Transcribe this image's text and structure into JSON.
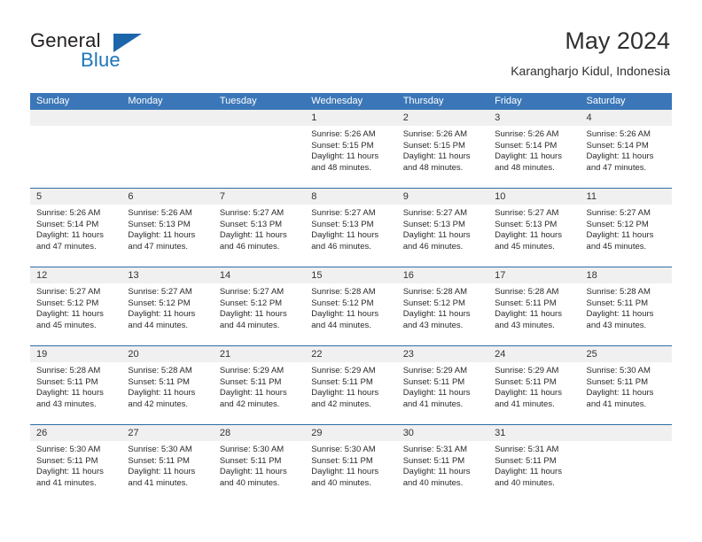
{
  "brand": {
    "word_general": "General",
    "word_blue": "Blue",
    "flag_icon": "blue-triangle-flag-icon"
  },
  "header": {
    "title": "May 2024",
    "subtitle": "Karangharjo Kidul, Indonesia"
  },
  "colors": {
    "header_blue": "#3b77b8",
    "row_divider_blue": "#2e6da4",
    "day_band_gray": "#f0f0f0",
    "brand_blue": "#1b75bb",
    "text": "#2a2a2a"
  },
  "weekdays": [
    "Sunday",
    "Monday",
    "Tuesday",
    "Wednesday",
    "Thursday",
    "Friday",
    "Saturday"
  ],
  "weeks": [
    [
      {
        "day": "",
        "sunrise": "",
        "sunset": "",
        "daylight_line1": "",
        "daylight_line2": "",
        "empty": true
      },
      {
        "day": "",
        "sunrise": "",
        "sunset": "",
        "daylight_line1": "",
        "daylight_line2": "",
        "empty": true
      },
      {
        "day": "",
        "sunrise": "",
        "sunset": "",
        "daylight_line1": "",
        "daylight_line2": "",
        "empty": true
      },
      {
        "day": "1",
        "sunrise": "Sunrise: 5:26 AM",
        "sunset": "Sunset: 5:15 PM",
        "daylight_line1": "Daylight: 11 hours",
        "daylight_line2": "and 48 minutes.",
        "empty": false
      },
      {
        "day": "2",
        "sunrise": "Sunrise: 5:26 AM",
        "sunset": "Sunset: 5:15 PM",
        "daylight_line1": "Daylight: 11 hours",
        "daylight_line2": "and 48 minutes.",
        "empty": false
      },
      {
        "day": "3",
        "sunrise": "Sunrise: 5:26 AM",
        "sunset": "Sunset: 5:14 PM",
        "daylight_line1": "Daylight: 11 hours",
        "daylight_line2": "and 48 minutes.",
        "empty": false
      },
      {
        "day": "4",
        "sunrise": "Sunrise: 5:26 AM",
        "sunset": "Sunset: 5:14 PM",
        "daylight_line1": "Daylight: 11 hours",
        "daylight_line2": "and 47 minutes.",
        "empty": false
      }
    ],
    [
      {
        "day": "5",
        "sunrise": "Sunrise: 5:26 AM",
        "sunset": "Sunset: 5:14 PM",
        "daylight_line1": "Daylight: 11 hours",
        "daylight_line2": "and 47 minutes.",
        "empty": false
      },
      {
        "day": "6",
        "sunrise": "Sunrise: 5:26 AM",
        "sunset": "Sunset: 5:13 PM",
        "daylight_line1": "Daylight: 11 hours",
        "daylight_line2": "and 47 minutes.",
        "empty": false
      },
      {
        "day": "7",
        "sunrise": "Sunrise: 5:27 AM",
        "sunset": "Sunset: 5:13 PM",
        "daylight_line1": "Daylight: 11 hours",
        "daylight_line2": "and 46 minutes.",
        "empty": false
      },
      {
        "day": "8",
        "sunrise": "Sunrise: 5:27 AM",
        "sunset": "Sunset: 5:13 PM",
        "daylight_line1": "Daylight: 11 hours",
        "daylight_line2": "and 46 minutes.",
        "empty": false
      },
      {
        "day": "9",
        "sunrise": "Sunrise: 5:27 AM",
        "sunset": "Sunset: 5:13 PM",
        "daylight_line1": "Daylight: 11 hours",
        "daylight_line2": "and 46 minutes.",
        "empty": false
      },
      {
        "day": "10",
        "sunrise": "Sunrise: 5:27 AM",
        "sunset": "Sunset: 5:13 PM",
        "daylight_line1": "Daylight: 11 hours",
        "daylight_line2": "and 45 minutes.",
        "empty": false
      },
      {
        "day": "11",
        "sunrise": "Sunrise: 5:27 AM",
        "sunset": "Sunset: 5:12 PM",
        "daylight_line1": "Daylight: 11 hours",
        "daylight_line2": "and 45 minutes.",
        "empty": false
      }
    ],
    [
      {
        "day": "12",
        "sunrise": "Sunrise: 5:27 AM",
        "sunset": "Sunset: 5:12 PM",
        "daylight_line1": "Daylight: 11 hours",
        "daylight_line2": "and 45 minutes.",
        "empty": false
      },
      {
        "day": "13",
        "sunrise": "Sunrise: 5:27 AM",
        "sunset": "Sunset: 5:12 PM",
        "daylight_line1": "Daylight: 11 hours",
        "daylight_line2": "and 44 minutes.",
        "empty": false
      },
      {
        "day": "14",
        "sunrise": "Sunrise: 5:27 AM",
        "sunset": "Sunset: 5:12 PM",
        "daylight_line1": "Daylight: 11 hours",
        "daylight_line2": "and 44 minutes.",
        "empty": false
      },
      {
        "day": "15",
        "sunrise": "Sunrise: 5:28 AM",
        "sunset": "Sunset: 5:12 PM",
        "daylight_line1": "Daylight: 11 hours",
        "daylight_line2": "and 44 minutes.",
        "empty": false
      },
      {
        "day": "16",
        "sunrise": "Sunrise: 5:28 AM",
        "sunset": "Sunset: 5:12 PM",
        "daylight_line1": "Daylight: 11 hours",
        "daylight_line2": "and 43 minutes.",
        "empty": false
      },
      {
        "day": "17",
        "sunrise": "Sunrise: 5:28 AM",
        "sunset": "Sunset: 5:11 PM",
        "daylight_line1": "Daylight: 11 hours",
        "daylight_line2": "and 43 minutes.",
        "empty": false
      },
      {
        "day": "18",
        "sunrise": "Sunrise: 5:28 AM",
        "sunset": "Sunset: 5:11 PM",
        "daylight_line1": "Daylight: 11 hours",
        "daylight_line2": "and 43 minutes.",
        "empty": false
      }
    ],
    [
      {
        "day": "19",
        "sunrise": "Sunrise: 5:28 AM",
        "sunset": "Sunset: 5:11 PM",
        "daylight_line1": "Daylight: 11 hours",
        "daylight_line2": "and 43 minutes.",
        "empty": false
      },
      {
        "day": "20",
        "sunrise": "Sunrise: 5:28 AM",
        "sunset": "Sunset: 5:11 PM",
        "daylight_line1": "Daylight: 11 hours",
        "daylight_line2": "and 42 minutes.",
        "empty": false
      },
      {
        "day": "21",
        "sunrise": "Sunrise: 5:29 AM",
        "sunset": "Sunset: 5:11 PM",
        "daylight_line1": "Daylight: 11 hours",
        "daylight_line2": "and 42 minutes.",
        "empty": false
      },
      {
        "day": "22",
        "sunrise": "Sunrise: 5:29 AM",
        "sunset": "Sunset: 5:11 PM",
        "daylight_line1": "Daylight: 11 hours",
        "daylight_line2": "and 42 minutes.",
        "empty": false
      },
      {
        "day": "23",
        "sunrise": "Sunrise: 5:29 AM",
        "sunset": "Sunset: 5:11 PM",
        "daylight_line1": "Daylight: 11 hours",
        "daylight_line2": "and 41 minutes.",
        "empty": false
      },
      {
        "day": "24",
        "sunrise": "Sunrise: 5:29 AM",
        "sunset": "Sunset: 5:11 PM",
        "daylight_line1": "Daylight: 11 hours",
        "daylight_line2": "and 41 minutes.",
        "empty": false
      },
      {
        "day": "25",
        "sunrise": "Sunrise: 5:30 AM",
        "sunset": "Sunset: 5:11 PM",
        "daylight_line1": "Daylight: 11 hours",
        "daylight_line2": "and 41 minutes.",
        "empty": false
      }
    ],
    [
      {
        "day": "26",
        "sunrise": "Sunrise: 5:30 AM",
        "sunset": "Sunset: 5:11 PM",
        "daylight_line1": "Daylight: 11 hours",
        "daylight_line2": "and 41 minutes.",
        "empty": false
      },
      {
        "day": "27",
        "sunrise": "Sunrise: 5:30 AM",
        "sunset": "Sunset: 5:11 PM",
        "daylight_line1": "Daylight: 11 hours",
        "daylight_line2": "and 41 minutes.",
        "empty": false
      },
      {
        "day": "28",
        "sunrise": "Sunrise: 5:30 AM",
        "sunset": "Sunset: 5:11 PM",
        "daylight_line1": "Daylight: 11 hours",
        "daylight_line2": "and 40 minutes.",
        "empty": false
      },
      {
        "day": "29",
        "sunrise": "Sunrise: 5:30 AM",
        "sunset": "Sunset: 5:11 PM",
        "daylight_line1": "Daylight: 11 hours",
        "daylight_line2": "and 40 minutes.",
        "empty": false
      },
      {
        "day": "30",
        "sunrise": "Sunrise: 5:31 AM",
        "sunset": "Sunset: 5:11 PM",
        "daylight_line1": "Daylight: 11 hours",
        "daylight_line2": "and 40 minutes.",
        "empty": false
      },
      {
        "day": "31",
        "sunrise": "Sunrise: 5:31 AM",
        "sunset": "Sunset: 5:11 PM",
        "daylight_line1": "Daylight: 11 hours",
        "daylight_line2": "and 40 minutes.",
        "empty": false
      },
      {
        "day": "",
        "sunrise": "",
        "sunset": "",
        "daylight_line1": "",
        "daylight_line2": "",
        "empty": true
      }
    ]
  ]
}
